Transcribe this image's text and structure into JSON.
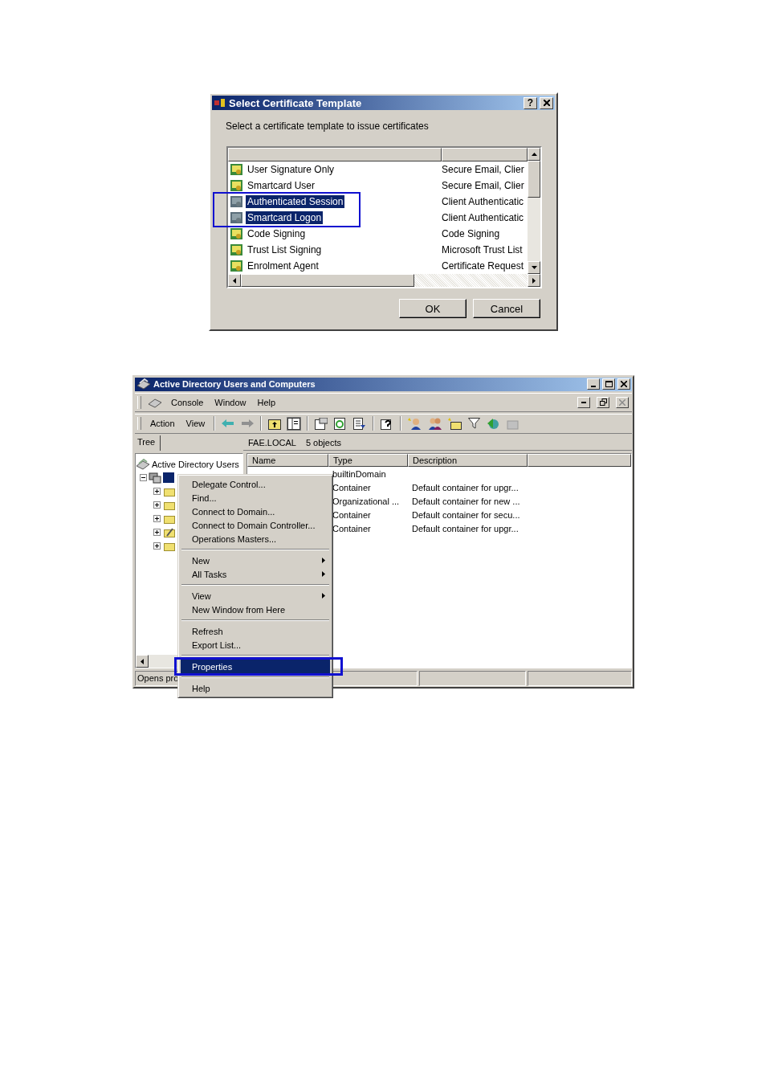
{
  "dialog": {
    "title": "Select Certificate Template",
    "help_button": "?",
    "prompt": "Select a certificate template to issue certificates",
    "templates": [
      {
        "name": "User Signature Only",
        "purpose": "Secure Email, Clier",
        "selected": false
      },
      {
        "name": "Smartcard User",
        "purpose": "Secure Email, Clier",
        "selected": false
      },
      {
        "name": "Authenticated Session",
        "purpose": "Client Authenticatic",
        "selected": true
      },
      {
        "name": "Smartcard Logon",
        "purpose": "Client Authenticatic",
        "selected": true
      },
      {
        "name": "Code Signing",
        "purpose": "Code Signing",
        "selected": false
      },
      {
        "name": "Trust List Signing",
        "purpose": "Microsoft Trust List",
        "selected": false
      },
      {
        "name": "Enrolment Agent",
        "purpose": "Certificate Request",
        "selected": false
      }
    ],
    "ok_button": "OK",
    "cancel_button": "Cancel"
  },
  "window": {
    "title": "Active Directory Users and Computers",
    "menu": [
      "Console",
      "Window",
      "Help"
    ],
    "action_menu": [
      "Action",
      "View"
    ],
    "tree_tab": "Tree",
    "path": "FAE.LOCAL",
    "object_count": "5 objects",
    "tree": {
      "label": "Active Directory Users",
      "children": [
        {
          "selected": true,
          "expanded": true,
          "children": [
            {
              "kind": "folder",
              "expanded": false
            },
            {
              "kind": "folder",
              "expanded": false
            },
            {
              "kind": "folder",
              "expanded": false
            },
            {
              "kind": "special",
              "expanded": false
            },
            {
              "kind": "folder",
              "expanded": false
            }
          ]
        }
      ]
    },
    "columns": [
      "Name",
      "Type",
      "Description"
    ],
    "rows": [
      {
        "type": "builtinDomain"
      },
      {
        "type": "Container",
        "description": "Default container for upgr..."
      },
      {
        "type": "Organizational ...",
        "description": "Default container for new ..."
      },
      {
        "type": "Container",
        "description": "Default container for secu..."
      },
      {
        "type": "Container",
        "description": "Default container for upgr..."
      }
    ],
    "context_menu": [
      [
        {
          "label": "Delegate Control...",
          "submenu": false,
          "selected": false
        },
        {
          "label": "Find...",
          "submenu": false,
          "selected": false
        },
        {
          "label": "Connect to Domain...",
          "submenu": false,
          "selected": false
        },
        {
          "label": "Connect to Domain Controller...",
          "submenu": false,
          "selected": false
        },
        {
          "label": "Operations Masters...",
          "submenu": false,
          "selected": false
        }
      ],
      [
        {
          "label": "New",
          "submenu": true,
          "selected": false
        },
        {
          "label": "All Tasks",
          "submenu": true,
          "selected": false
        }
      ],
      [
        {
          "label": "View",
          "submenu": true,
          "selected": false
        },
        {
          "label": "New Window from Here",
          "submenu": false,
          "selected": false
        }
      ],
      [
        {
          "label": "Refresh",
          "submenu": false,
          "selected": false
        },
        {
          "label": "Export List...",
          "submenu": false,
          "selected": false
        }
      ],
      [
        {
          "label": "Properties",
          "submenu": false,
          "selected": true
        }
      ],
      [
        {
          "label": "Help",
          "submenu": false,
          "selected": false
        }
      ]
    ],
    "status": "Opens pro"
  }
}
